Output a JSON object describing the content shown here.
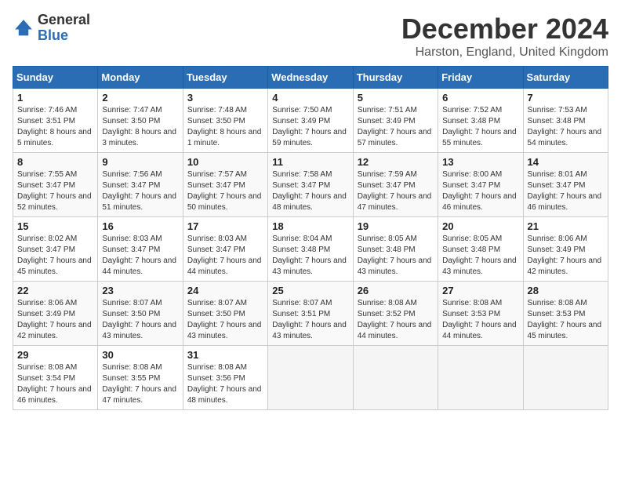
{
  "header": {
    "logo_general": "General",
    "logo_blue": "Blue",
    "month_title": "December 2024",
    "location": "Harston, England, United Kingdom"
  },
  "weekdays": [
    "Sunday",
    "Monday",
    "Tuesday",
    "Wednesday",
    "Thursday",
    "Friday",
    "Saturday"
  ],
  "weeks": [
    [
      {
        "day": "1",
        "sunrise": "7:46 AM",
        "sunset": "3:51 PM",
        "daylight": "8 hours and 5 minutes."
      },
      {
        "day": "2",
        "sunrise": "7:47 AM",
        "sunset": "3:50 PM",
        "daylight": "8 hours and 3 minutes."
      },
      {
        "day": "3",
        "sunrise": "7:48 AM",
        "sunset": "3:50 PM",
        "daylight": "8 hours and 1 minute."
      },
      {
        "day": "4",
        "sunrise": "7:50 AM",
        "sunset": "3:49 PM",
        "daylight": "7 hours and 59 minutes."
      },
      {
        "day": "5",
        "sunrise": "7:51 AM",
        "sunset": "3:49 PM",
        "daylight": "7 hours and 57 minutes."
      },
      {
        "day": "6",
        "sunrise": "7:52 AM",
        "sunset": "3:48 PM",
        "daylight": "7 hours and 55 minutes."
      },
      {
        "day": "7",
        "sunrise": "7:53 AM",
        "sunset": "3:48 PM",
        "daylight": "7 hours and 54 minutes."
      }
    ],
    [
      {
        "day": "8",
        "sunrise": "7:55 AM",
        "sunset": "3:47 PM",
        "daylight": "7 hours and 52 minutes."
      },
      {
        "day": "9",
        "sunrise": "7:56 AM",
        "sunset": "3:47 PM",
        "daylight": "7 hours and 51 minutes."
      },
      {
        "day": "10",
        "sunrise": "7:57 AM",
        "sunset": "3:47 PM",
        "daylight": "7 hours and 50 minutes."
      },
      {
        "day": "11",
        "sunrise": "7:58 AM",
        "sunset": "3:47 PM",
        "daylight": "7 hours and 48 minutes."
      },
      {
        "day": "12",
        "sunrise": "7:59 AM",
        "sunset": "3:47 PM",
        "daylight": "7 hours and 47 minutes."
      },
      {
        "day": "13",
        "sunrise": "8:00 AM",
        "sunset": "3:47 PM",
        "daylight": "7 hours and 46 minutes."
      },
      {
        "day": "14",
        "sunrise": "8:01 AM",
        "sunset": "3:47 PM",
        "daylight": "7 hours and 46 minutes."
      }
    ],
    [
      {
        "day": "15",
        "sunrise": "8:02 AM",
        "sunset": "3:47 PM",
        "daylight": "7 hours and 45 minutes."
      },
      {
        "day": "16",
        "sunrise": "8:03 AM",
        "sunset": "3:47 PM",
        "daylight": "7 hours and 44 minutes."
      },
      {
        "day": "17",
        "sunrise": "8:03 AM",
        "sunset": "3:47 PM",
        "daylight": "7 hours and 44 minutes."
      },
      {
        "day": "18",
        "sunrise": "8:04 AM",
        "sunset": "3:48 PM",
        "daylight": "7 hours and 43 minutes."
      },
      {
        "day": "19",
        "sunrise": "8:05 AM",
        "sunset": "3:48 PM",
        "daylight": "7 hours and 43 minutes."
      },
      {
        "day": "20",
        "sunrise": "8:05 AM",
        "sunset": "3:48 PM",
        "daylight": "7 hours and 43 minutes."
      },
      {
        "day": "21",
        "sunrise": "8:06 AM",
        "sunset": "3:49 PM",
        "daylight": "7 hours and 42 minutes."
      }
    ],
    [
      {
        "day": "22",
        "sunrise": "8:06 AM",
        "sunset": "3:49 PM",
        "daylight": "7 hours and 42 minutes."
      },
      {
        "day": "23",
        "sunrise": "8:07 AM",
        "sunset": "3:50 PM",
        "daylight": "7 hours and 43 minutes."
      },
      {
        "day": "24",
        "sunrise": "8:07 AM",
        "sunset": "3:50 PM",
        "daylight": "7 hours and 43 minutes."
      },
      {
        "day": "25",
        "sunrise": "8:07 AM",
        "sunset": "3:51 PM",
        "daylight": "7 hours and 43 minutes."
      },
      {
        "day": "26",
        "sunrise": "8:08 AM",
        "sunset": "3:52 PM",
        "daylight": "7 hours and 44 minutes."
      },
      {
        "day": "27",
        "sunrise": "8:08 AM",
        "sunset": "3:53 PM",
        "daylight": "7 hours and 44 minutes."
      },
      {
        "day": "28",
        "sunrise": "8:08 AM",
        "sunset": "3:53 PM",
        "daylight": "7 hours and 45 minutes."
      }
    ],
    [
      {
        "day": "29",
        "sunrise": "8:08 AM",
        "sunset": "3:54 PM",
        "daylight": "7 hours and 46 minutes."
      },
      {
        "day": "30",
        "sunrise": "8:08 AM",
        "sunset": "3:55 PM",
        "daylight": "7 hours and 47 minutes."
      },
      {
        "day": "31",
        "sunrise": "8:08 AM",
        "sunset": "3:56 PM",
        "daylight": "7 hours and 48 minutes."
      },
      null,
      null,
      null,
      null
    ]
  ],
  "labels": {
    "sunrise": "Sunrise: ",
    "sunset": "Sunset: ",
    "daylight": "Daylight: "
  }
}
